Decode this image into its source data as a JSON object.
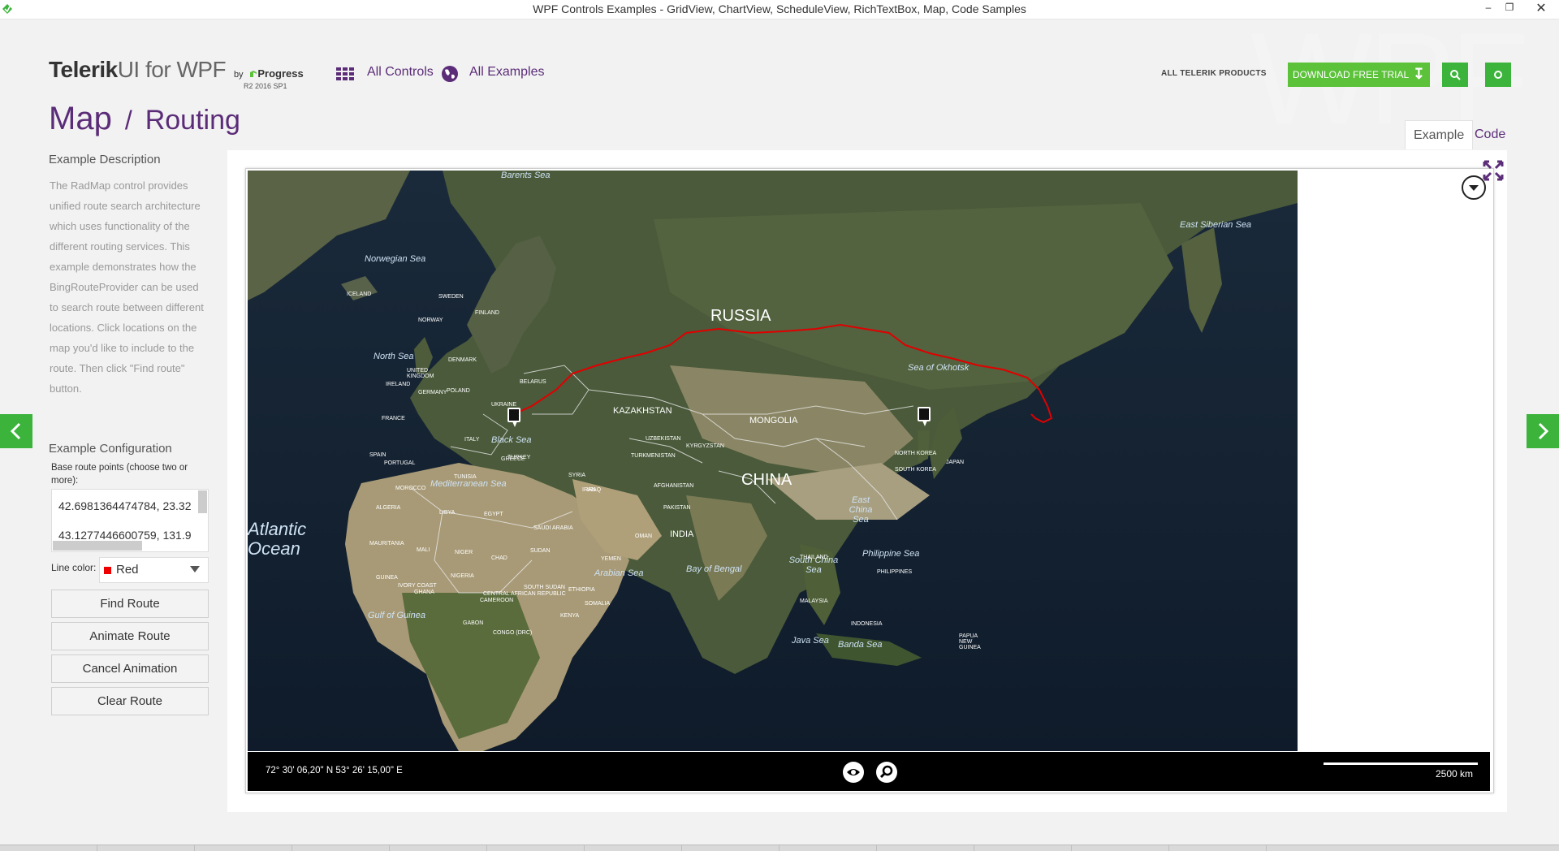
{
  "window": {
    "title": "WPF Controls Examples - GridView, ChartView, ScheduleView, RichTextBox, Map, Code Samples",
    "minimize": "–",
    "maximize": "❐",
    "close": "✕"
  },
  "header": {
    "watermark": "WPF",
    "logo_brand": "Telerik",
    "logo_product": "UI for WPF",
    "logo_by": "by",
    "logo_company": "Progress",
    "version": "R2 2016 SP1",
    "all_controls": "All Controls",
    "all_examples": "All Examples",
    "all_products": "ALL TELERIK PRODUCTS",
    "download": "DOWNLOAD FREE TRIAL"
  },
  "breadcrumb": {
    "control": "Map",
    "separator": "/",
    "example": "Routing"
  },
  "tabs": [
    {
      "label": "Example",
      "active": true
    },
    {
      "label": "Code",
      "active": false
    }
  ],
  "sidebar": {
    "description_title": "Example Description",
    "description": "The RadMap control provides unified route search architecture which uses functionality of the different routing services. This example demonstrates how the BingRouteProvider can be used to search route between different locations. Click locations on the map you'd like to include to the route. Then click \"Find route\" button.",
    "config_title": "Example Configuration",
    "points_label": "Base route points (choose two or more):",
    "points": [
      "42.6981364474784, 23.32",
      "43.1277446600759, 131.9"
    ],
    "line_color_label": "Line color:",
    "line_color": "Red",
    "line_color_hex": "#e00000",
    "buttons": {
      "find": "Find Route",
      "animate": "Animate Route",
      "cancel": "Cancel Animation",
      "clear": "Clear Route"
    }
  },
  "map": {
    "seas": [
      "Barents Sea",
      "East Siberian Sea",
      "Norwegian Sea",
      "North Sea",
      "Sea of Okhotsk",
      "Black Sea",
      "Mediterranean Sea",
      "East China Sea",
      "Philippine Sea",
      "South China Sea",
      "Arabian Sea",
      "Bay of Bengal",
      "Gulf of Guinea",
      "Java Sea",
      "Banda Sea",
      "Atlantic Ocean"
    ],
    "countries_major": [
      "RUSSIA",
      "CHINA"
    ],
    "countries": [
      "KAZAKHSTAN",
      "MONGOLIA",
      "INDIA",
      "TURKEY",
      "ALGERIA",
      "LIBYA",
      "EGYPT",
      "SAUDI ARABIA",
      "IRAN",
      "FRANCE",
      "SPAIN",
      "UKRAINE",
      "POLAND",
      "GERMANY",
      "FINLAND",
      "SWEDEN",
      "NORWAY",
      "ICELAND",
      "IRELAND",
      "UNITED KINGDOM",
      "ITALY",
      "GREECE",
      "MALI",
      "NIGER",
      "CHAD",
      "SUDAN",
      "NIGERIA",
      "ETHIOPIA",
      "KENYA",
      "JAPAN",
      "NORTH KOREA",
      "SOUTH KOREA",
      "PAKISTAN",
      "AFGHANISTAN",
      "MOROCCO",
      "MAURITANIA",
      "INDONESIA",
      "THAILAND",
      "MALAYSIA",
      "PHILIPPINES",
      "YEMEN",
      "OMAN",
      "IRAQ",
      "SYRIA",
      "TUNISIA",
      "BELARUS",
      "DENMARK",
      "PORTUGAL",
      "UZBEKISTAN",
      "TURKMENISTAN",
      "KYRGYZSTAN",
      "PAPUA NEW GUINEA",
      "CONGO (DRC)",
      "GABON",
      "CAMEROON",
      "SOUTH SUDAN",
      "SOMALIA",
      "GUINEA",
      "IVORY COAST",
      "GHANA",
      "CENTRAL AFRICAN REPUBLIC"
    ],
    "coordinates": "72° 30' 06,20\" N 53° 26' 15,00\" E",
    "scale": "2500 km",
    "route_color": "#e00000"
  }
}
